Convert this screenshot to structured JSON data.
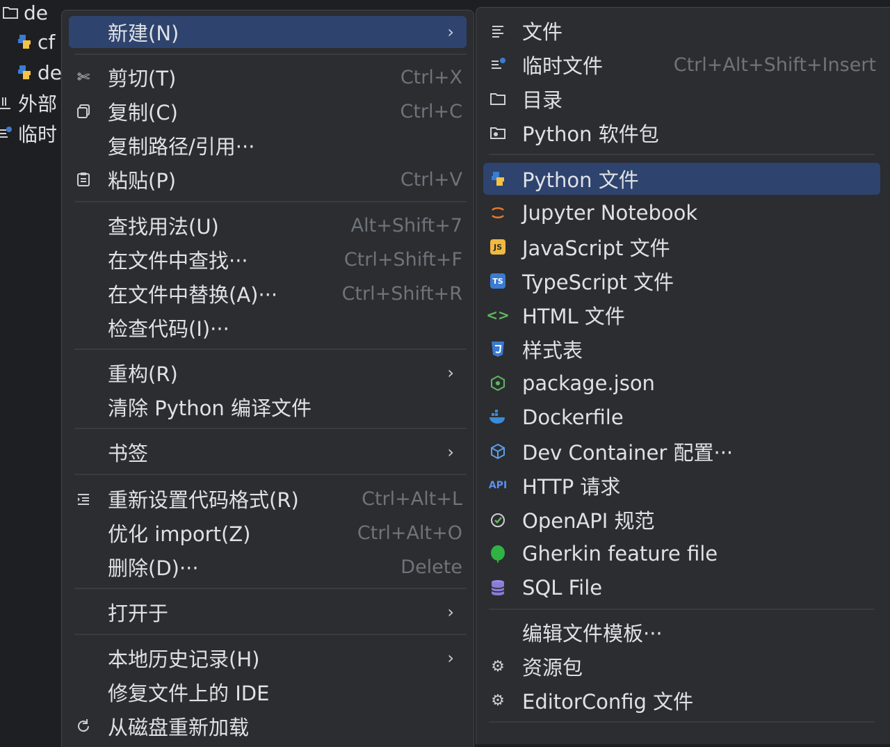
{
  "project_tree": {
    "items": [
      {
        "label": "de",
        "icon": "folder-icon"
      },
      {
        "label": "cf",
        "icon": "python-file-icon"
      },
      {
        "label": "de",
        "icon": "python-file-icon"
      },
      {
        "label": "外部",
        "icon": "library-icon"
      },
      {
        "label": "临时",
        "icon": "scratch-icon"
      }
    ]
  },
  "main_menu": {
    "new": "新建(N)",
    "cut": "剪切(T)",
    "cut_shortcut": "Ctrl+X",
    "copy": "复制(C)",
    "copy_shortcut": "Ctrl+C",
    "copy_path": "复制路径/引用···",
    "paste": "粘贴(P)",
    "paste_shortcut": "Ctrl+V",
    "find_usages": "查找用法(U)",
    "find_usages_shortcut": "Alt+Shift+7",
    "find_in_files": "在文件中查找···",
    "find_in_files_shortcut": "Ctrl+Shift+F",
    "replace_in_files": "在文件中替换(A)···",
    "replace_in_files_shortcut": "Ctrl+Shift+R",
    "inspect_code": "检查代码(I)···",
    "refactor": "重构(R)",
    "clean_python": "清除 Python 编译文件",
    "bookmarks": "书签",
    "reformat": "重新设置代码格式(R)",
    "reformat_shortcut": "Ctrl+Alt+L",
    "optimize_imports": "优化 import(Z)",
    "optimize_imports_shortcut": "Ctrl+Alt+O",
    "delete": "删除(D)···",
    "delete_shortcut": "Delete",
    "open_in": "打开于",
    "local_history": "本地历史记录(H)",
    "repair_ide": "修复文件上的 IDE",
    "reload_from_disk": "从磁盘重新加载",
    "submenu_arrow": "›"
  },
  "new_submenu": {
    "file": "文件",
    "scratch_file": "临时文件",
    "scratch_shortcut": "Ctrl+Alt+Shift+Insert",
    "directory": "目录",
    "python_package": "Python 软件包",
    "python_file": "Python 文件",
    "jupyter": "Jupyter Notebook",
    "javascript": "JavaScript 文件",
    "typescript": "TypeScript 文件",
    "html": "HTML 文件",
    "stylesheet": "样式表",
    "package_json": "package.json",
    "dockerfile": "Dockerfile",
    "dev_container": "Dev Container 配置···",
    "http_request": "HTTP 请求",
    "openapi": "OpenAPI 规范",
    "gherkin": "Gherkin feature file",
    "sql": "SQL File",
    "edit_templates": "编辑文件模板···",
    "resource_bundle": "资源包",
    "editorconfig": "EditorConfig 文件",
    "js_badge": "JS",
    "ts_badge": "TS",
    "api_badge": "API",
    "html_glyph": "<>"
  },
  "colors": {
    "menu_bg": "#2b2d30",
    "selection": "#2e436e",
    "shortcut_text": "#6f737a",
    "text": "#dfe1e5"
  }
}
